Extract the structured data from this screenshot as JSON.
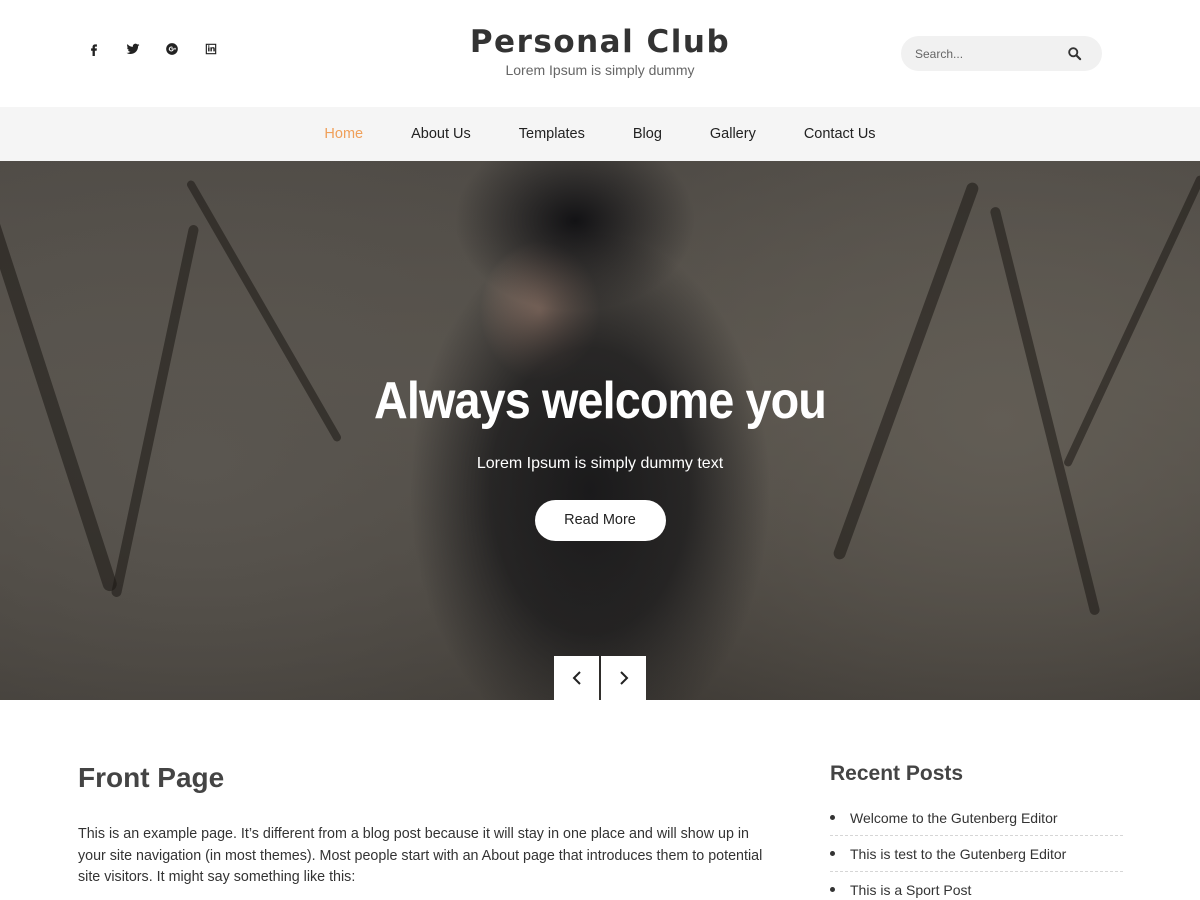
{
  "header": {
    "social": [
      {
        "icon": "facebook-icon",
        "label": "f"
      },
      {
        "icon": "twitter-icon",
        "label": "twitter"
      },
      {
        "icon": "google-plus-icon",
        "label": "google plus"
      },
      {
        "icon": "linkedin-icon",
        "label": "linkedin"
      }
    ],
    "site_title": "Personal Club",
    "tagline": "Lorem Ipsum is simply dummy",
    "search": {
      "placeholder": "Search...",
      "icon": "search-icon"
    }
  },
  "nav": {
    "items": [
      "Home",
      "About Us",
      "Templates",
      "Blog",
      "Gallery",
      "Contact Us"
    ],
    "active": "Home",
    "active_color": "#f0a05a"
  },
  "hero": {
    "title": "Always welcome you",
    "subtitle": "Lorem Ipsum is simply dummy text",
    "button": "Read More",
    "prev_icon": "chevron-left-icon",
    "next_icon": "chevron-right-icon"
  },
  "main": {
    "title": "Front Page",
    "text": "This is an example page. It’s different from a blog post because it will stay in one place and will show up in your site navigation (in most themes). Most people start with an About page that introduces them to potential site visitors. It might say something like this:"
  },
  "sidebar": {
    "widget_title": "Recent Posts",
    "posts": [
      "Welcome to the Gutenberg Editor",
      "This is test to the Gutenberg Editor",
      "This is a Sport Post"
    ]
  }
}
